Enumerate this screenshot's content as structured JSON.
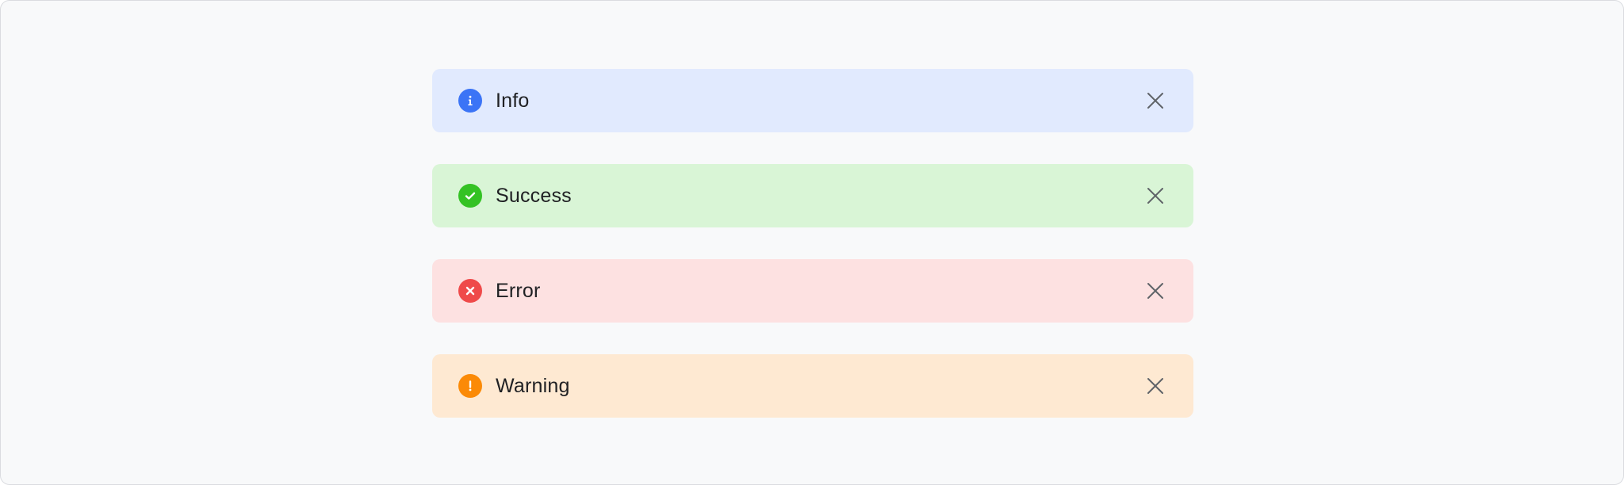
{
  "alerts": [
    {
      "label": "Info",
      "icon": "info-icon",
      "background": "#e1eafe",
      "accent": "#3b74f6"
    },
    {
      "label": "Success",
      "icon": "check-icon",
      "background": "#d9f5d6",
      "accent": "#34c224"
    },
    {
      "label": "Error",
      "icon": "error-x-icon",
      "background": "#fde1e1",
      "accent": "#ef4a4a"
    },
    {
      "label": "Warning",
      "icon": "exclamation-icon",
      "background": "#fee9d2",
      "accent": "#fb8a07"
    }
  ],
  "close_icon": "close-icon",
  "close_color": "#5f6368"
}
